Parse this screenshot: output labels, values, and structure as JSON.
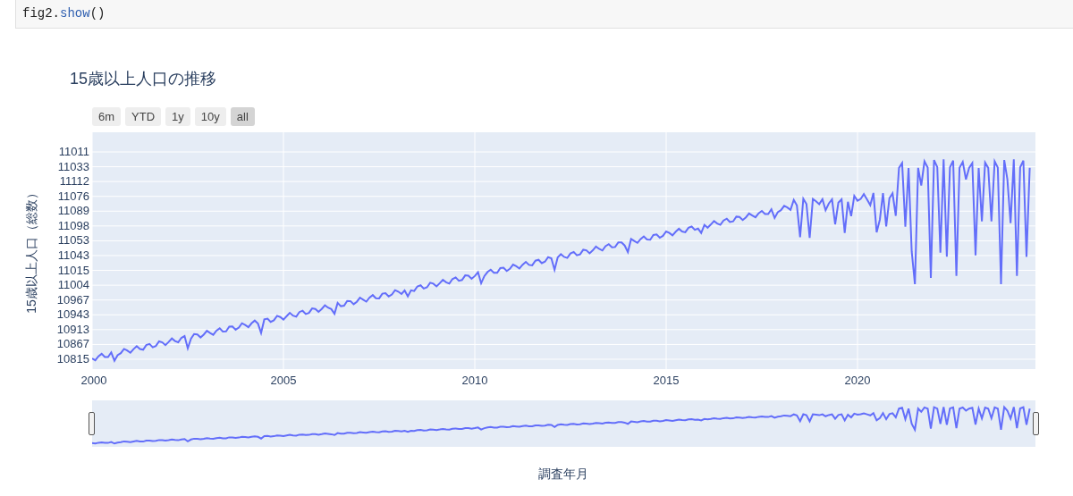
{
  "code_cell": {
    "parts": [
      {
        "text": "fig2.",
        "kind": "plain"
      },
      {
        "text": "show",
        "kind": "method"
      },
      {
        "text": "()",
        "kind": "plain"
      }
    ]
  },
  "figure": {
    "title": "15歳以上人口の推移",
    "range_buttons": [
      {
        "label": "6m",
        "selected": false
      },
      {
        "label": "YTD",
        "selected": false
      },
      {
        "label": "1y",
        "selected": false
      },
      {
        "label": "10y",
        "selected": false
      },
      {
        "label": "all",
        "selected": true
      }
    ],
    "yaxis_title": "15歳以上人口（総数）",
    "yticks": [
      "11011",
      "11033",
      "11112",
      "11076",
      "11089",
      "11098",
      "11053",
      "11043",
      "11015",
      "11004",
      "10967",
      "10943",
      "10913",
      "10867",
      "10815"
    ],
    "xticks": [
      "2000",
      "2005",
      "2010",
      "2015",
      "2020"
    ],
    "range_slider": {
      "level": 1
    },
    "xaxis_title": "調査年月"
  }
}
